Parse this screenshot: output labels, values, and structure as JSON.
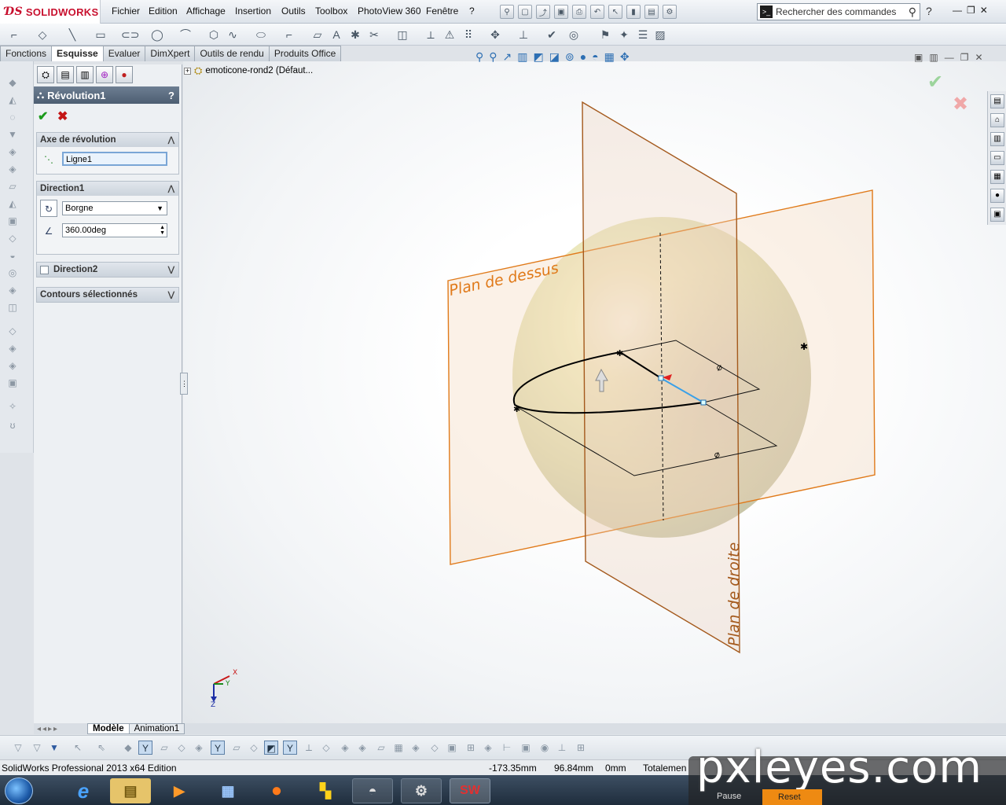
{
  "app": {
    "logo_text": "SOLIDWORKS",
    "accent": "#c8102e"
  },
  "menu": [
    "Fichier",
    "Edition",
    "Affichage",
    "Insertion",
    "Outils",
    "Toolbox",
    "PhotoView 360",
    "Fenêtre",
    "?"
  ],
  "search": {
    "placeholder": "Rechercher des commandes"
  },
  "tabs": [
    {
      "label": "Fonctions",
      "active": false
    },
    {
      "label": "Esquisse",
      "active": true
    },
    {
      "label": "Evaluer",
      "active": false
    },
    {
      "label": "DimXpert",
      "active": false
    },
    {
      "label": "Outils de rendu",
      "active": false
    },
    {
      "label": "Produits Office",
      "active": false
    }
  ],
  "tree": {
    "root": "emoticone-rond2  (Défaut..."
  },
  "property_manager": {
    "title": "Révolution1",
    "help": "?",
    "axis": {
      "heading": "Axe de révolution",
      "value": "Ligne1"
    },
    "direction1": {
      "heading": "Direction1",
      "type": "Borgne",
      "angle": "360.00deg"
    },
    "direction2": {
      "heading": "Direction2",
      "checked": false
    },
    "contours": {
      "heading": "Contours sélectionnés"
    }
  },
  "viewport": {
    "plane_top_label": "Plan de dessus",
    "plane_right_label": "Plan de droite",
    "plane_color": "#e07a1a",
    "body_color": "#eeeab8",
    "axes": {
      "x": "X",
      "y": "Y",
      "z": "Z"
    }
  },
  "bottom_tabs": [
    {
      "label": "Modèle",
      "active": true
    },
    {
      "label": "Animation1",
      "active": false
    }
  ],
  "status": {
    "edition": "SolidWorks Professional 2013 x64 Edition",
    "x": "-173.35mm",
    "y": "96.84mm",
    "z": "0mm",
    "state": "Totalemen"
  },
  "watermark": "pxleyes.com",
  "media": {
    "pause": "Pause",
    "reset": "Reset"
  }
}
